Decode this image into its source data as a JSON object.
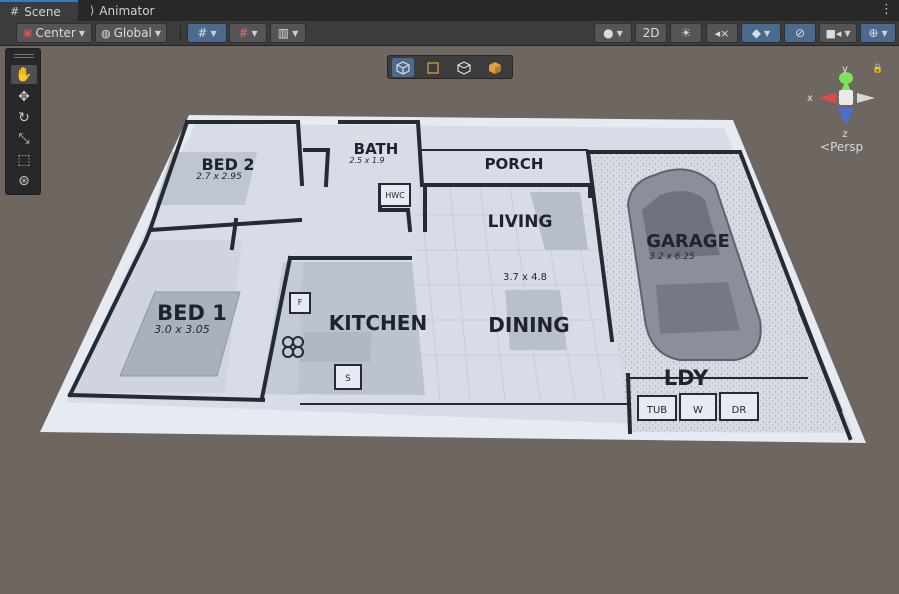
{
  "tabs": [
    {
      "label": "Scene",
      "icon": "grid-icon"
    },
    {
      "label": "Animator",
      "icon": "animator-icon"
    }
  ],
  "toolbar": {
    "pivot_label": "Center",
    "space_label": "Global",
    "mode_2d_label": "2D"
  },
  "gizmo": {
    "y_label": "y",
    "x_label": "x",
    "z_label": "z",
    "projection_label": "Persp"
  },
  "floorplan": {
    "rooms": [
      {
        "name": "BED 2",
        "dims": "2.7 x 2.95"
      },
      {
        "name": "BATH",
        "dims": "2.5 x 1.9"
      },
      {
        "name": "PORCH",
        "dims": ""
      },
      {
        "name": "LIVING",
        "dims": ""
      },
      {
        "name": "GARAGE",
        "dims": "3.2 x 6.25"
      },
      {
        "name": "BED 1",
        "dims": "3.0 x 3.05"
      },
      {
        "name": "KITCHEN",
        "dims": ""
      },
      {
        "name": "DINING",
        "dims": "3.7 x 4.8"
      },
      {
        "name": "LDY",
        "dims": ""
      }
    ],
    "fixtures": [
      "HWC",
      "F",
      "S",
      "TUB",
      "W",
      "DR"
    ]
  },
  "colors": {
    "accent": "#3a79bb",
    "toolbar_on": "#4a6a8e",
    "ground": "#6e6661",
    "gizmo_y": "#7de35b",
    "gizmo_x": "#e64848",
    "gizmo_z": "#4a6fd1"
  }
}
